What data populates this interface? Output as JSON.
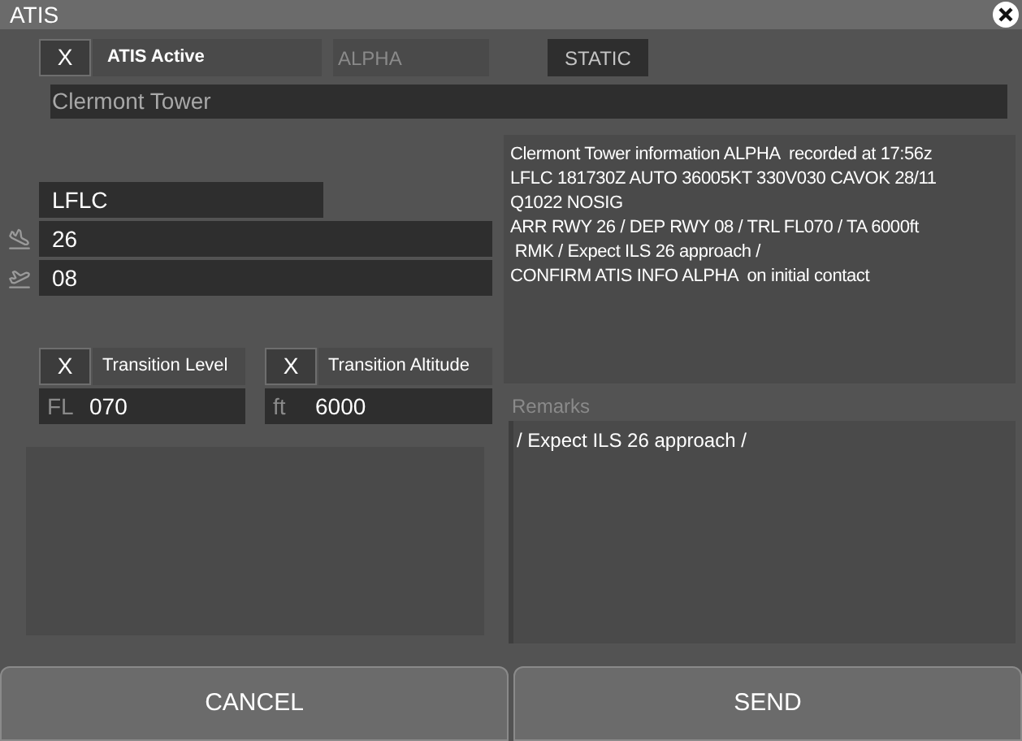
{
  "window": {
    "title": "ATIS"
  },
  "atis_active": {
    "checked": true,
    "mark": "X",
    "label": "ATIS Active"
  },
  "letter": "ALPHA",
  "mode_button": "STATIC",
  "station": "Clermont Tower",
  "airport": "LFLC",
  "runways": [
    {
      "kind": "arrival",
      "value": "26"
    },
    {
      "kind": "departure",
      "value": "08"
    }
  ],
  "transitions": [
    {
      "checked": true,
      "mark": "X",
      "label": "Transition Level",
      "unit": "FL",
      "value": "070"
    },
    {
      "checked": true,
      "mark": "X",
      "label": "Transition Altitude",
      "unit": "ft",
      "value": "6000"
    }
  ],
  "atis_text": [
    "Clermont Tower information ALPHA  recorded at 17:56z",
    "LFLC 181730Z AUTO 36005KT 330V030 CAVOK 28/11",
    "Q1022 NOSIG",
    "ARR RWY 26 / DEP RWY 08 / TRL FL070 / TA 6000ft",
    " RMK / Expect ILS 26 approach /",
    "CONFIRM ATIS INFO ALPHA  on initial contact"
  ],
  "remarks": {
    "label": "Remarks",
    "value": "/ Expect ILS 26 approach /"
  },
  "buttons": [
    "CANCEL",
    "SEND"
  ]
}
